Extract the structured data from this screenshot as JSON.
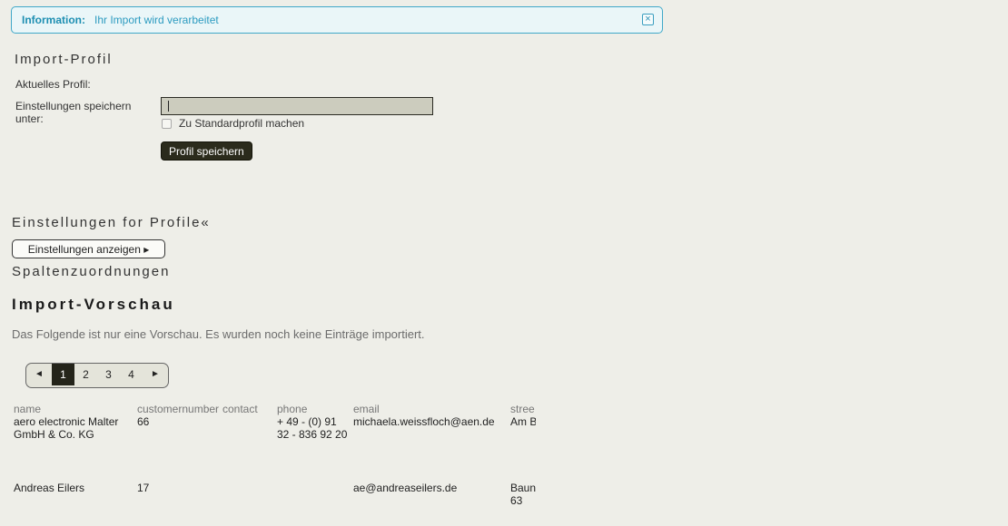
{
  "info": {
    "label": "Information:",
    "message": "Ihr Import wird verarbeitet",
    "close_icon": "×"
  },
  "import_profile": {
    "heading": "Import-Profil",
    "current_profile_label": "Aktuelles Profil:",
    "save_label_line1": "Einstellungen speichern",
    "save_label_line2": "unter:",
    "input_value": "",
    "checkbox_label": "Zu Standardprofil machen",
    "save_button": "Profil speichern"
  },
  "settings": {
    "heading": "Einstellungen for Profile«",
    "show_button": "Einstellungen anzeigen ▸",
    "mapping_heading": "Spaltenzuordnungen"
  },
  "preview": {
    "heading": "Import-Vorschau",
    "note": "Das Folgende ist nur eine Vorschau. Es wurden noch keine Einträge importiert.",
    "pager": {
      "prev": "◄",
      "pages": [
        "1",
        "2",
        "3",
        "4"
      ],
      "active": "1",
      "next": "►"
    },
    "columns": [
      "name",
      "customernumber",
      "contact",
      "phone",
      "email",
      "stree"
    ],
    "rows": [
      {
        "name": "aero electronic Malter GmbH & Co. KG",
        "customernumber": "66",
        "contact": "",
        "phone": "+ 49 - (0) 91 32 - 836 92 20",
        "email": "michaela.weissfloch@aen.de",
        "street": "Am B"
      },
      {
        "name": "Andreas Eilers",
        "customernumber": "17",
        "contact": "",
        "phone": "",
        "email": "ae@andreaseilers.de",
        "street": "Baun 63"
      }
    ]
  }
}
